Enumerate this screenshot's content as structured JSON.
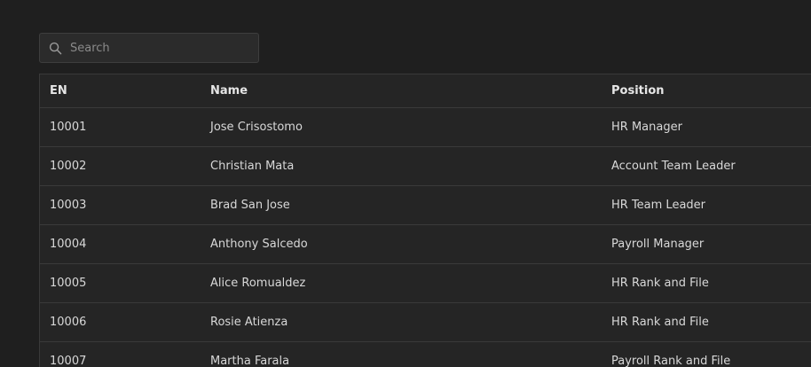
{
  "search": {
    "placeholder": "Search",
    "icon": "search-icon"
  },
  "table": {
    "columns": [
      "EN",
      "Name",
      "Position"
    ],
    "rows": [
      {
        "en": "10001",
        "name": "Jose Crisostomo",
        "position": "HR Manager"
      },
      {
        "en": "10002",
        "name": "Christian Mata",
        "position": "Account Team Leader"
      },
      {
        "en": "10003",
        "name": "Brad San Jose",
        "position": "HR Team Leader"
      },
      {
        "en": "10004",
        "name": "Anthony Salcedo",
        "position": "Payroll Manager"
      },
      {
        "en": "10005",
        "name": "Alice Romualdez",
        "position": "HR Rank and File"
      },
      {
        "en": "10006",
        "name": "Rosie Atienza",
        "position": "HR Rank and File"
      },
      {
        "en": "10007",
        "name": "Martha Farala",
        "position": "Payroll Rank and File"
      }
    ]
  },
  "colors": {
    "background": "#1f1f1f",
    "table_background": "#252525",
    "border": "#3a3a3a",
    "text": "#d8d8d8"
  }
}
